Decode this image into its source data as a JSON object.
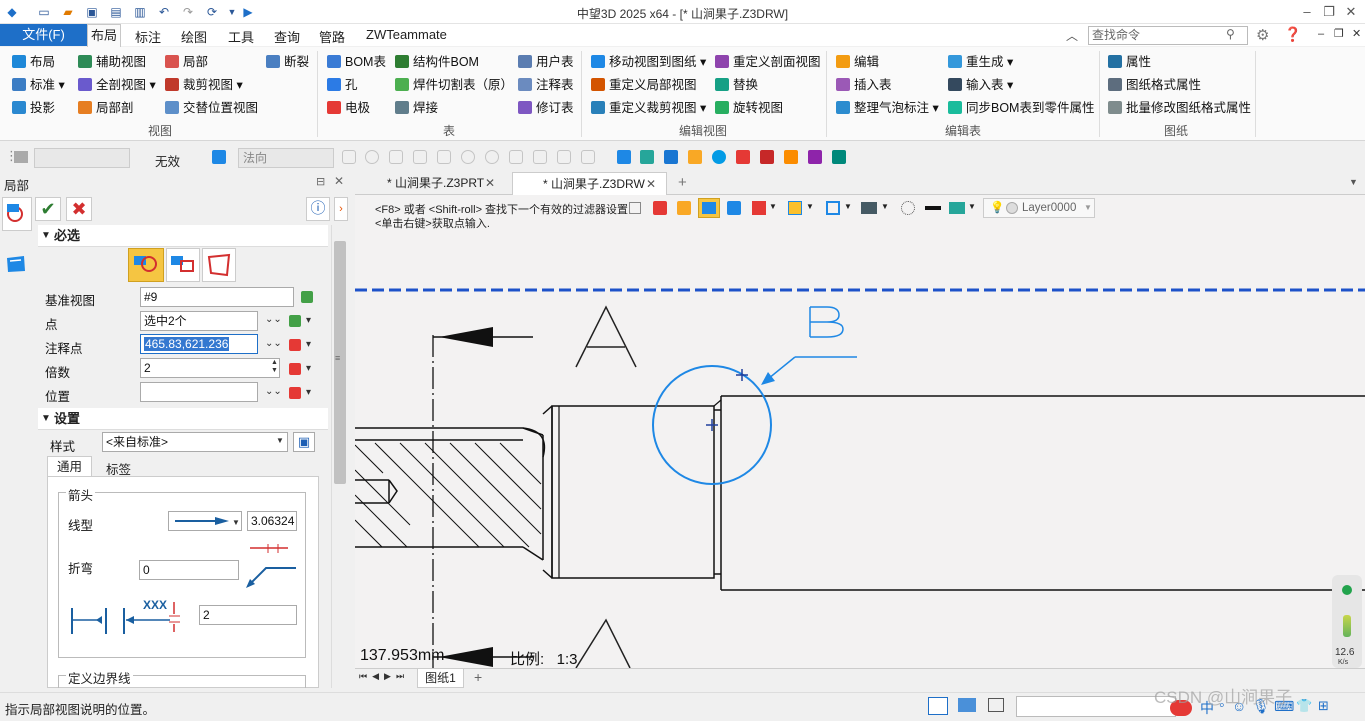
{
  "app": {
    "title": "中望3D 2025 x64 - [* 山涧果子.Z3DRW]"
  },
  "menu": {
    "file": "文件(F)",
    "tabs": [
      "布局",
      "标注",
      "绘图",
      "工具",
      "查询",
      "管路",
      "ZWTeammate"
    ],
    "search_placeholder": "查找命令"
  },
  "ribbon": {
    "view": {
      "label": "视图",
      "items": [
        "布局",
        "辅助视图",
        "局部",
        "断裂",
        "标准",
        "全剖视图",
        "裁剪视图",
        "投影",
        "局部剖",
        "交替位置视图"
      ]
    },
    "table": {
      "label": "表",
      "items": [
        "BOM表",
        "结构件BOM",
        "用户表",
        "孔",
        "焊件切割表（原）",
        "注释表",
        "电极",
        "焊接",
        "修订表"
      ]
    },
    "edit": {
      "label": "编辑视图",
      "items": [
        "移动视图到图纸",
        "重定义剖面视图",
        "重定义局部视图",
        "替换",
        "重定义裁剪视图",
        "旋转视图"
      ]
    },
    "edit_table": {
      "label": "编辑表",
      "items": [
        "编辑",
        "重生成",
        "插入表",
        "输入表",
        "整理气泡标注",
        "同步BOM表到零件属性"
      ]
    },
    "drawing": {
      "label": "图纸",
      "items": [
        "属性",
        "图纸格式属性",
        "批量修改图纸格式属性"
      ]
    }
  },
  "toolbar2": {
    "invalid": "无效",
    "normal": "法向"
  },
  "panel": {
    "title": "局部",
    "required": "必选",
    "base_view_label": "基准视图",
    "base_view": "#9",
    "point_label": "点",
    "point": "选中2个",
    "annotation_label": "注释点",
    "annotation": "465.83,621.236",
    "scale_label": "倍数",
    "scale": "2",
    "position_label": "位置",
    "position": "",
    "settings": "设置",
    "style_label": "样式",
    "style": "<来自标准>",
    "tab_general": "通用",
    "tab_label": "标签",
    "arrow_group": "箭头",
    "line_type_label": "线型",
    "arrow_size": "3.06324",
    "bend_label": "折弯",
    "bend": "0",
    "gap_sample": "XXX",
    "gap": "2",
    "boundary": "定义边界线"
  },
  "doc_tabs": [
    {
      "label": "* 山涧果子.Z3PRT"
    },
    {
      "label": "* 山涧果子.Z3DRW"
    }
  ],
  "canvas": {
    "hint1": "<F8> 或者 <Shift-roll> 查找下一个有效的过滤器设置.",
    "hint2": "<单击右键>获取点输入.",
    "layer": "Layer0000",
    "label_a": "A",
    "label_b": "B",
    "measure": "137.953mm",
    "scale_text": "比例:   1:3",
    "sheet_tab": "图纸1",
    "speed": "12.6",
    "speed_unit": "K/s"
  },
  "status": {
    "text": "指示局部视图说明的位置。",
    "watermark": "CSDN @山涧果子"
  }
}
